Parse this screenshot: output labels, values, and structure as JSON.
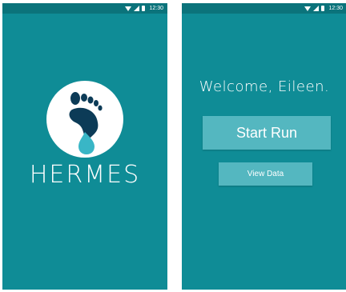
{
  "status_bar": {
    "time": "12:30",
    "icons": [
      "wifi-icon",
      "signal-icon",
      "battery-icon"
    ]
  },
  "splash": {
    "brand": "HERMES",
    "logo_icon": "footprint-drop-icon"
  },
  "home": {
    "welcome": "Welcome, Eileen.",
    "start_run_label": "Start Run",
    "view_data_label": "View Data"
  },
  "colors": {
    "background": "#0f8c96",
    "status_bar": "#0b737b",
    "button": "#54b7c0",
    "logo_dark": "#0c3b57",
    "logo_drop": "#39b6c6"
  }
}
